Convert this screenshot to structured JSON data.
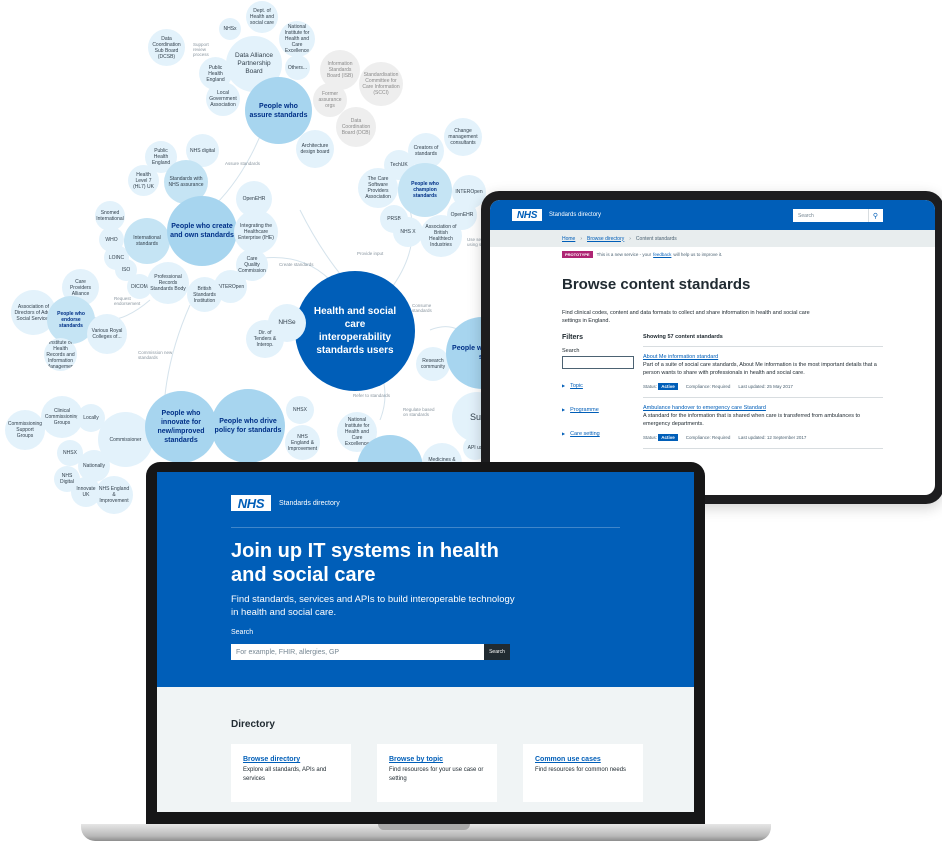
{
  "diagram": {
    "hub": "Health and social care interoperability standards users",
    "groups": {
      "assure": "People who assure standards",
      "create": "People who create and own standards",
      "champion": "People who champion standards",
      "endorse": "People who endorse standards",
      "innovate": "People who innovate for new/improved standards",
      "policy": "People who drive policy for standards",
      "adopt": "People who adopt st",
      "people_who": "People who",
      "sup": "Sup"
    },
    "nodes": {
      "data_alliance": "Data Alliance Partnership Board",
      "dcsb": "Data Coordination Sub Board (DCSB)",
      "nhsx_top": "NHSx",
      "dhsc": "Dept. of Health and social care",
      "nice": "National Institute for Health and Care Excellence",
      "others": "Others...",
      "phe": "Public Health England",
      "lga": "Local Government Association",
      "isb": "Information Standards Board (ISB)",
      "scci": "Standardisation Committee for Care Information (SCCI)",
      "former": "Former assurance orgs",
      "dcb": "Data Coordination Board (DCB)",
      "architecture": "Architecture design board",
      "phe2": "Public Health England",
      "nhs_digital": "NHS digital",
      "hl7uk": "Health Level 7 (HL7) UK",
      "with_nhs": "Standards with NHS assurance",
      "creators": "Creators of standards",
      "change": "Change management consultants",
      "techuk": "TechUK",
      "care_software": "The Care Software Providers Association",
      "interopen_c": "INTEROpen",
      "prsb": "PRSB",
      "nhsx_c": "NHS X",
      "openehr_c": "OpenEHR",
      "abhi": "Association of British Healthtech Industries",
      "snomed": "Snomed International",
      "who": "WHO",
      "loinc": "LOINC",
      "iso": "ISO",
      "dicom": "DICOM",
      "intl": "International standards",
      "openehr": "OpenEHR",
      "ihe": "Integrating the Healthcare Enterprise (IHE)",
      "cqc": "Care Quality Commission",
      "interopen": "INTEROpen",
      "prsb_full": "Professional Records Standards Body",
      "bsi": "British Standards Institution",
      "nhse": "NHSe",
      "dit": "Dir. of Tenders & Interop.",
      "care_providers": "Care Providers Alliance",
      "adass": "Association of Directors of Adult Social Services",
      "royal": "Various Royal Colleges of...",
      "inst_health": "Institute of Health Records and Information Management",
      "research": "Research community",
      "ccg": "Clinical Commissioning Groups",
      "csu": "Commissioning Support Groups",
      "locally": "Locally",
      "commissioner": "Commissioner",
      "nhsx_b": "NHSX",
      "nhs_digital_b": "NHS Digital",
      "nationally": "Nationally",
      "innovate_uk": "Innovate UK",
      "nhs_england": "NHS England & Improvement",
      "nhsx_p": "NHSX",
      "nhse_p": "NHS England & Improvement",
      "nice_b": "National Institute for Health and Care Excellence",
      "medicines": "Medicines & Healthcare",
      "api": "API us"
    },
    "edges": {
      "assure": "Assure standards",
      "create": "Create standards",
      "provide": "Provide input",
      "request": "Request endorsement",
      "commission": "Commission new standards",
      "refer": "Refer to standards",
      "regulate": "Regulate based on standards",
      "consume": "Consume standards",
      "use_apis": "Use ser using st",
      "support": "Support review process"
    }
  },
  "tablet": {
    "logo": "NHS",
    "service_name": "Standards directory",
    "search_placeholder": "Search",
    "breadcrumb": [
      "Home",
      "Browse directory",
      "Content standards"
    ],
    "beta_tag": "PROTOTYPE",
    "beta_text_before": "This is a new service - your",
    "beta_link": "feedback",
    "beta_text_after": "will help us to improve it.",
    "title": "Browse content standards",
    "lede": "Find clinical codes, content and data formats to collect and share information in health and social care settings in England.",
    "filters_heading": "Filters",
    "search_label": "Search",
    "filters": [
      "Topic",
      "Programme",
      "Care setting"
    ],
    "results_count": "Showing 57 content standards",
    "results": [
      {
        "title": "About Me information standard",
        "desc": "Part of a suite of social care standards, About Me information is the most important details that a person wants to share with professionals in health and social care.",
        "status_label": "Status:",
        "status": "Active",
        "compliance": "Compliance: Required",
        "updated": "Last updated: 25 May 2017"
      },
      {
        "title": "Ambulance handover to emergency care Standard",
        "desc": "A standard for the information that is shared when care is transferred from ambulances to emergency departments.",
        "status_label": "Status:",
        "status": "Active",
        "compliance": "Compliance: Required",
        "updated": "Last updated: 12 September 2017"
      }
    ]
  },
  "laptop": {
    "logo": "NHS",
    "service_name": "Standards directory",
    "hero_title": "Join up IT systems in health and social care",
    "hero_text": "Find standards, services and APIs to build interoperable technology in health and social care.",
    "search_label": "Search",
    "search_placeholder": "For example, FHIR, allergies, GP",
    "search_button": "Search",
    "directory_heading": "Directory",
    "cards": [
      {
        "title": "Browse directory",
        "desc": "Explore all standards, APIs and services"
      },
      {
        "title": "Browse by topic",
        "desc": "Find resources for your use case or setting"
      },
      {
        "title": "Common use cases",
        "desc": "Find resources for common needs"
      }
    ]
  },
  "colors": {
    "nhs_blue": "#005eb8",
    "bubble_light": "#e3f2fb",
    "bubble_mid": "#a7d5ef",
    "page_grey": "#f0f4f5"
  }
}
